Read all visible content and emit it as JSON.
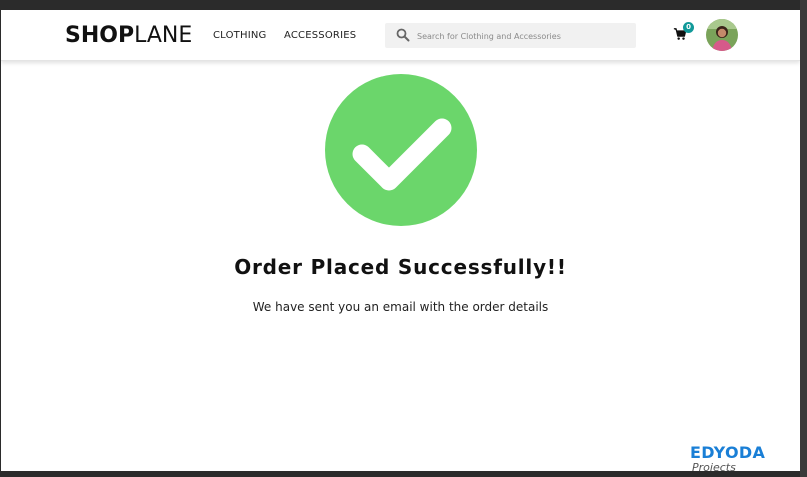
{
  "header": {
    "logo_bold": "SHOP",
    "logo_light": "LANE",
    "nav": [
      {
        "label": "CLOTHING"
      },
      {
        "label": "ACCESSORIES"
      }
    ],
    "search": {
      "placeholder": "Search for Clothing and Accessories"
    },
    "cart_count": "0"
  },
  "main": {
    "title": "Order Placed Successfully!!",
    "subtitle": "We have sent you an email with the order details"
  },
  "watermark": {
    "main": "EDYODA",
    "sub": "Projects"
  },
  "colors": {
    "success": "#6bd66b",
    "badge": "#119999",
    "watermark": "#1a7fd6"
  }
}
